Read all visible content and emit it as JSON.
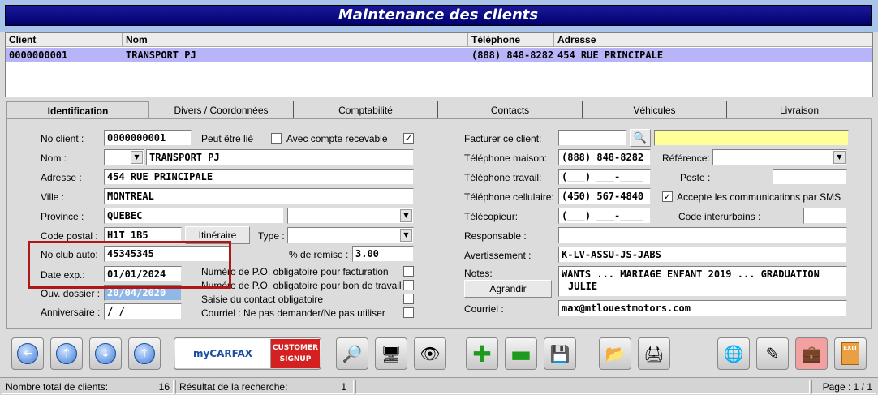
{
  "window": {
    "title": "Maintenance des clients"
  },
  "list": {
    "headers": [
      "Client",
      "Nom",
      "Téléphone",
      "Adresse"
    ],
    "rows": [
      [
        "0000000001",
        "TRANSPORT PJ",
        "(888) 848-8282",
        "454 RUE PRINCIPALE"
      ]
    ]
  },
  "tabs": [
    "Identification",
    "Divers / Coordonnées",
    "Comptabilité",
    "Contacts",
    "Véhicules",
    "Livraison"
  ],
  "left": {
    "no_client_label": "No client :",
    "no_client": "0000000001",
    "peut_etre_lie": "Peut être lié",
    "compte_recevable_label": "Avec compte recevable",
    "nom_label": "Nom :",
    "nom": "TRANSPORT PJ",
    "adresse_label": "Adresse :",
    "adresse": "454 RUE PRINCIPALE",
    "ville_label": "Ville :",
    "ville": "MONTREAL",
    "province_label": "Province :",
    "province": "QUEBEC",
    "code_postal_label": "Code postal :",
    "code_postal": "H1T 1B5",
    "itineraire_button": "Itinéraire",
    "type_label": "Type :",
    "club_label": "No club auto:",
    "club": "45345345",
    "remise_label": "% de remise :",
    "remise": "3.00",
    "date_exp_label": "Date exp.:",
    "date_exp": "01/01/2024",
    "ouv_label": "Ouv. dossier :",
    "ouv": "20/04/2020",
    "anniversaire_label": "Anniversaire :",
    "anniversaire": "/ /",
    "opt1": "Numéro de P.O. obligatoire pour facturation",
    "opt2": "Numéro de P.O. obligatoire pour bon de travail",
    "opt3": "Saisie du contact obligatoire",
    "opt4": "Courriel : Ne pas demander/Ne pas utiliser"
  },
  "right": {
    "facturer_label": "Facturer ce client:",
    "tel_maison_label": "Téléphone maison:",
    "tel_maison": "(888) 848-8282",
    "reference_label": "Référence:",
    "tel_travail_label": "Téléphone travail:",
    "tel_travail": "(___) ___-____",
    "poste_label": "Poste :",
    "tel_cell_label": "Téléphone cellulaire:",
    "tel_cell": "(450) 567-4840",
    "sms_label": "Accepte les communications par SMS",
    "telecopieur_label": "Télécopieur:",
    "telecopieur": "(___) ___-____",
    "code_interurbains_label": "Code interurbains :",
    "responsable_label": "Responsable :",
    "avertissement_label": "Avertissement :",
    "avertissement": "K-LV-ASSU-JS-JABS",
    "notes_label": "Notes:",
    "notes_line1": "WANTS ... MARIAGE ENFANT 2019 ... GRADUATION",
    "notes_line2": "JULIE",
    "agrandir_button": "Agrandir",
    "courriel_label": "Courriel :",
    "courriel": "max@mtlouestmotors.com"
  },
  "toolbar": {
    "carfax_brand": "myCARFAX",
    "carfax_signup": "CUSTOMER SIGNUP",
    "exit_label": "EXIT"
  },
  "status": {
    "total_label": "Nombre total de clients:",
    "total": "16",
    "search_label": "Résultat de la recherche:",
    "search": "1",
    "page": "Page : 1 / 1"
  },
  "colors": {
    "title_bg": "#00006e",
    "selected_row": "#b8b4f8",
    "highlight_field": "#ffff99",
    "red_frame": "#b01818"
  }
}
